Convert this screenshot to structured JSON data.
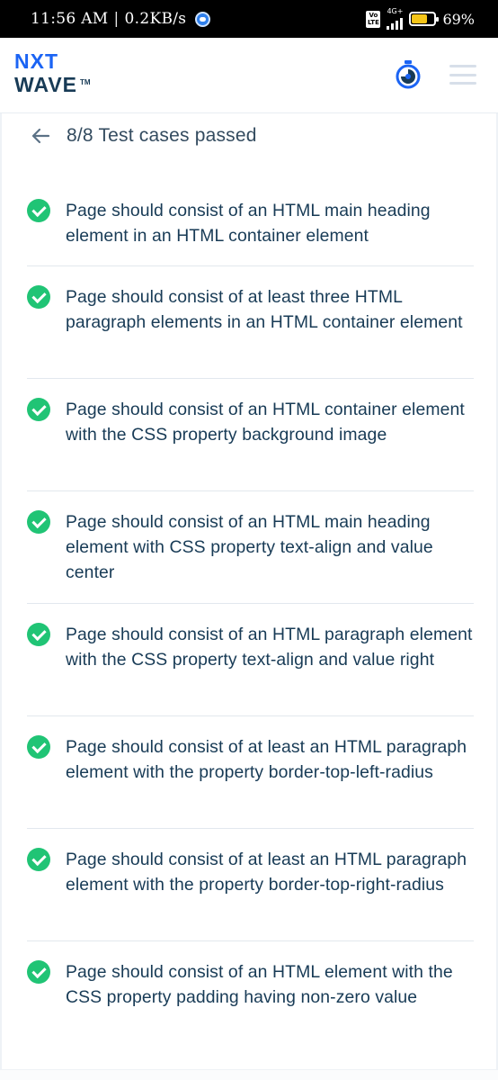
{
  "status_bar": {
    "time": "11:56 AM",
    "separator": "|",
    "data_speed": "0.2KB/s",
    "volte_top": "Vo",
    "volte_bottom": "LTE",
    "network_type": "4G+",
    "battery_percent_text": "69%",
    "battery_level": 0.69,
    "battery_color": "#f5c518"
  },
  "header": {
    "logo_line1": "NXT",
    "logo_line2": "WAVE",
    "logo_tm": "TM",
    "timer_icon": "stopwatch-icon",
    "menu_icon": "hamburger-menu-icon",
    "brand_color": "#1b64f4"
  },
  "results": {
    "back_icon": "arrow-left-icon",
    "title": "8/8 Test cases passed",
    "status_icon": "check-circle-icon",
    "success_color": "#20c475",
    "cases": [
      {
        "text": "Page should consist of an HTML main heading element in an HTML container element"
      },
      {
        "text": "Page should consist of at least three HTML paragraph elements in an HTML container element"
      },
      {
        "text": "Page should consist of an HTML container element with the CSS property background image"
      },
      {
        "text": "Page should consist of an HTML main heading element with CSS property text-align and value center"
      },
      {
        "text": "Page should consist of an HTML paragraph element with the CSS property text-align and value right"
      },
      {
        "text": "Page should consist of at least an HTML paragraph element with the property border-top-left-radius"
      },
      {
        "text": "Page should consist of at least an HTML paragraph element with the property border-top-right-radius"
      },
      {
        "text": "Page should consist of an HTML element with the CSS property padding having non-zero value"
      }
    ]
  }
}
